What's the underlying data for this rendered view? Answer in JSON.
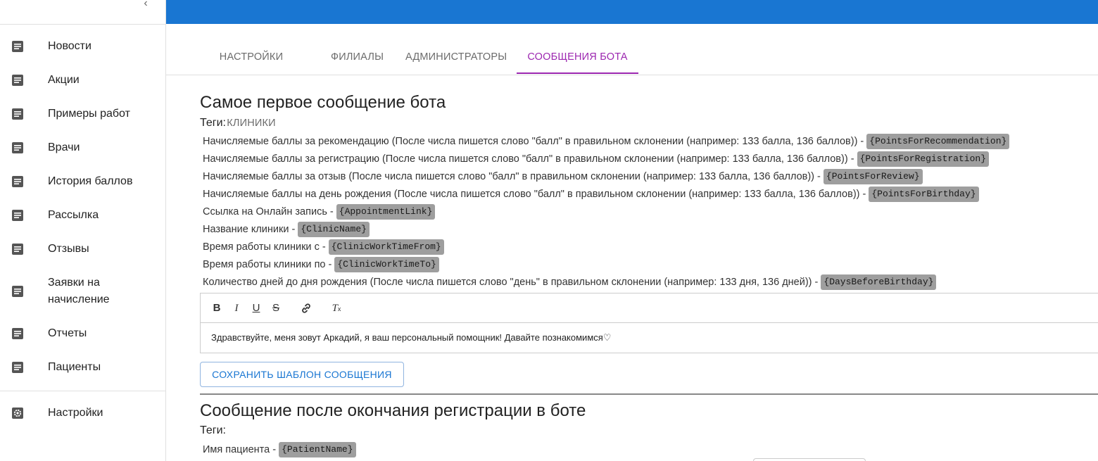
{
  "sidebar": {
    "collapse_icon": "chevron-left-icon",
    "items": [
      {
        "label": "Новости",
        "icon": "document-icon"
      },
      {
        "label": "Акции",
        "icon": "document-icon"
      },
      {
        "label": "Примеры работ",
        "icon": "document-icon"
      },
      {
        "label": "Врачи",
        "icon": "document-icon"
      },
      {
        "label": "История баллов",
        "icon": "document-icon"
      },
      {
        "label": "Рассылка",
        "icon": "document-icon"
      },
      {
        "label": "Отзывы",
        "icon": "document-icon"
      },
      {
        "label": "Заявки на начисление",
        "icon": "document-icon"
      },
      {
        "label": "Отчеты",
        "icon": "document-icon"
      },
      {
        "label": "Пациенты",
        "icon": "document-icon"
      }
    ],
    "settings": {
      "label": "Настройки",
      "icon": "gear-icon"
    }
  },
  "colors": {
    "topbar": "#1976d2",
    "active_tab": "#9c27b0",
    "tag_bg": "#9e9e9e",
    "button_text": "#1976d2"
  },
  "tabs": [
    {
      "label": "НАСТРОЙКИ КЛИНИКИ",
      "active": false
    },
    {
      "label": "ФИЛИАЛЫ",
      "active": false
    },
    {
      "label": "АДМИНИСТРАТОРЫ",
      "active": false
    },
    {
      "label": "СООБЩЕНИЯ БОТА",
      "active": true
    }
  ],
  "section1": {
    "title": "Самое первое сообщение бота",
    "tags_label": "Теги:",
    "tags": [
      {
        "text": "Начисляемые баллы за рекомендацию (После числа пишется слово \"балл\" в правильном склонении (например: 133 балла, 136 баллов)) - ",
        "code": "{PointsForRecommendation}"
      },
      {
        "text": "Начисляемые баллы за регистрацию (После числа пишется слово \"балл\" в правильном склонении (например: 133 балла, 136 баллов)) - ",
        "code": "{PointsForRegistration}"
      },
      {
        "text": "Начисляемые баллы за отзыв (После числа пишется слово \"балл\" в правильном склонении (например: 133 балла, 136 баллов)) - ",
        "code": "{PointsForReview}"
      },
      {
        "text": "Начисляемые баллы на день рождения (После числа пишется слово \"балл\" в правильном склонении (например: 133 балла, 136 баллов)) - ",
        "code": "{PointsForBirthday}"
      },
      {
        "text": "Ссылка на Онлайн запись - ",
        "code": "{AppointmentLink}"
      },
      {
        "text": "Название клиники - ",
        "code": "{ClinicName}"
      },
      {
        "text": "Время работы клиники с - ",
        "code": "{ClinicWorkTimeFrom}"
      },
      {
        "text": "Время работы клиники по - ",
        "code": "{ClinicWorkTimeTo}"
      },
      {
        "text": "Количество дней до дня рождения (После числа пишется слово \"день\" в правильном склонении (например: 133 дня, 136 дней)) - ",
        "code": "{DaysBeforeBirthday}"
      }
    ],
    "editor": {
      "toolbar": {
        "bold": "B",
        "italic": "I",
        "underline": "U",
        "strike": "S",
        "link_icon": "link-icon",
        "clear_format": "Tx"
      },
      "content": "Здравствуйте, меня зовут Аркадий, я ваш персональный помощник! Давайте познакомимся♡"
    },
    "save_button": "СОХРАНИТЬ ШАБЛОН СООБЩЕНИЯ"
  },
  "section2": {
    "title": "Сообщение после окончания регистрации в боте",
    "tags_label": "Теги:",
    "tags": [
      {
        "text": "Имя пациента - ",
        "code": "{PatientName}"
      }
    ]
  }
}
